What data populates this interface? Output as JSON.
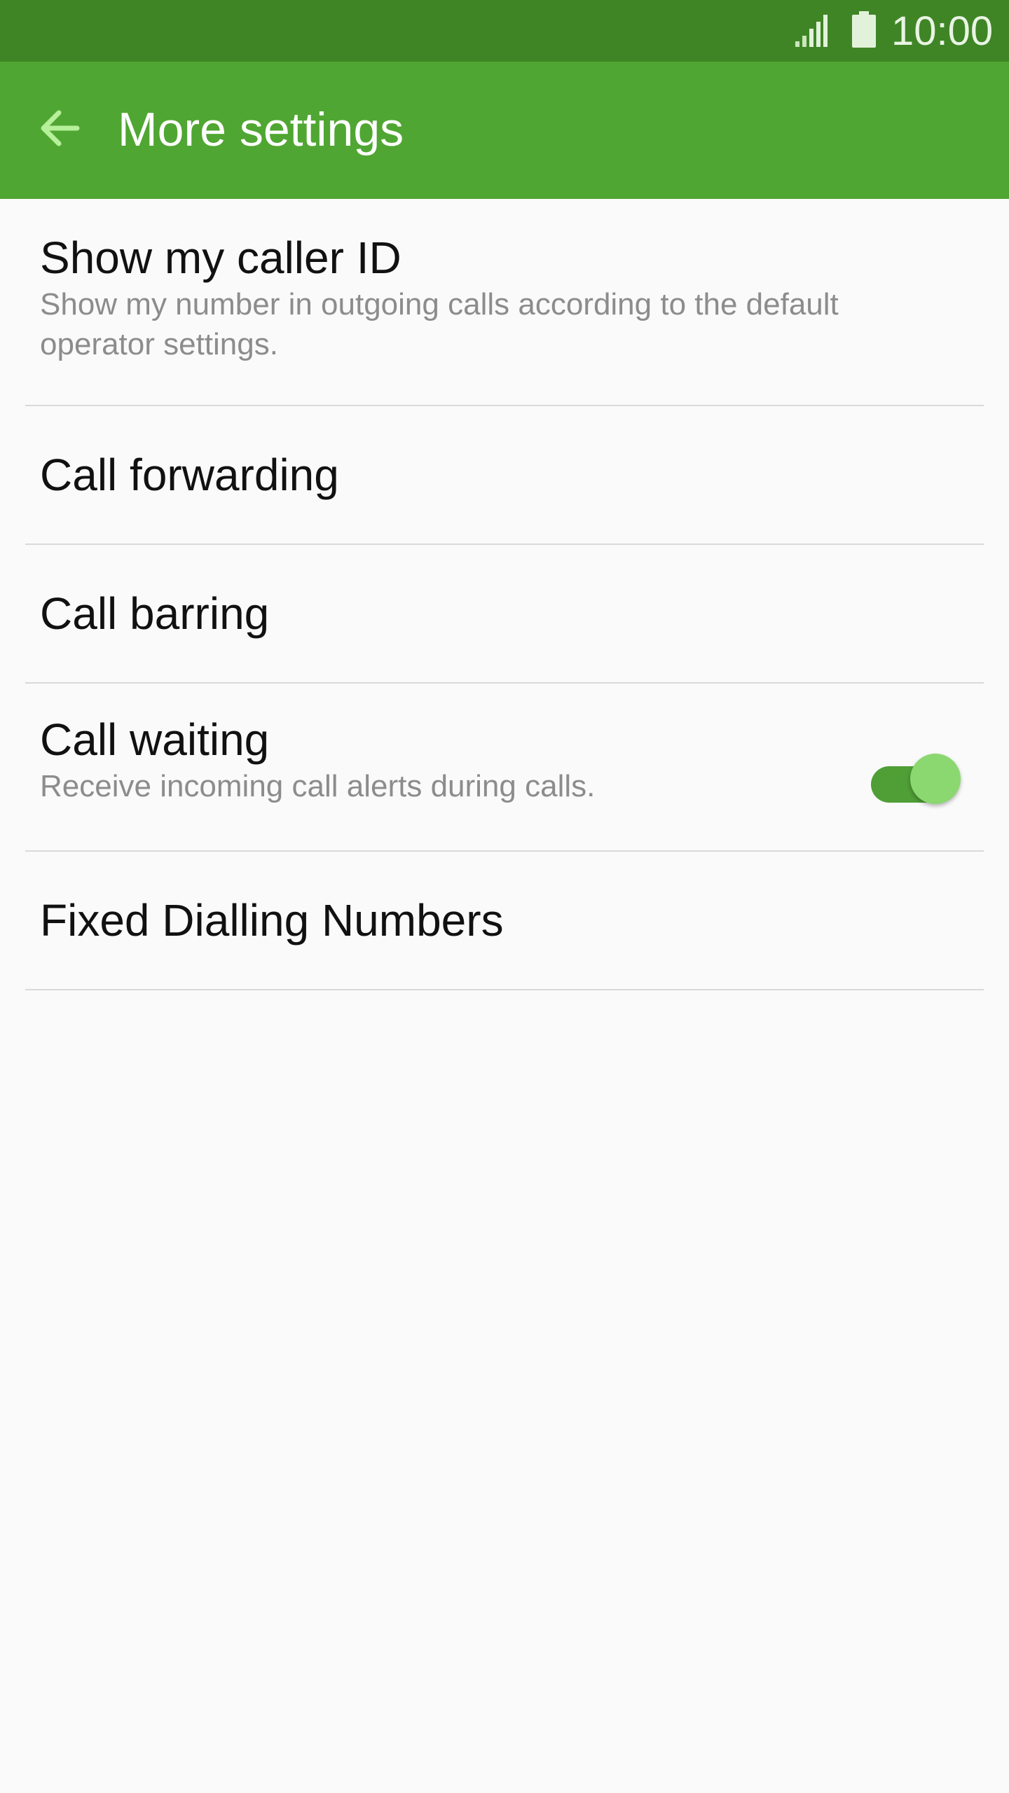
{
  "status_bar": {
    "time": "10:00",
    "signal_icon": "signal-icon",
    "battery_icon": "battery-icon"
  },
  "app_bar": {
    "title": "More settings",
    "back_icon": "arrow-left-icon"
  },
  "settings": {
    "caller_id": {
      "label": "Show my caller ID",
      "description": "Show my number in outgoing calls according to the default operator settings."
    },
    "call_forwarding": {
      "label": "Call forwarding"
    },
    "call_barring": {
      "label": "Call barring"
    },
    "call_waiting": {
      "label": "Call waiting",
      "description": "Receive incoming call alerts during calls.",
      "enabled": true
    },
    "fixed_dialling": {
      "label": "Fixed Dialling Numbers"
    }
  },
  "colors": {
    "status_bar": "#3f8526",
    "app_bar": "#50a632",
    "back_arrow": "#b6f09a",
    "toggle_track": "#4f9e36",
    "toggle_thumb": "#8ad86f"
  }
}
